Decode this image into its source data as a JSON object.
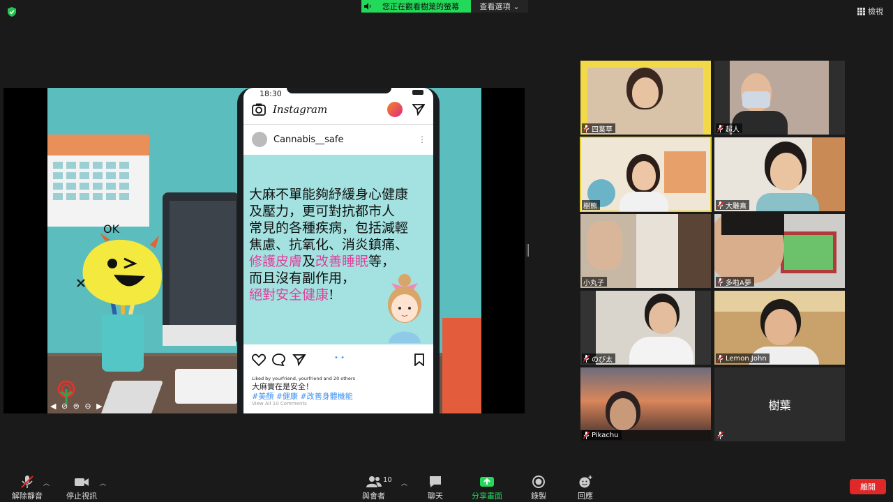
{
  "top": {
    "banner_text": "您正在觀看樹葉的螢幕",
    "view_options": "查看選項",
    "view_button": "檢視"
  },
  "slide": {
    "status_time": "18:30",
    "app_name": "Instagram",
    "account": "Cannabis__safe",
    "post_lines": [
      "大麻不單能夠紓緩身心健康",
      "及壓力，更可對抗都市人",
      "常見的各種疾病，包括減輕",
      "焦慮、抗氧化、消炎鎮痛、"
    ],
    "post_line5_hl1": "修護皮膚",
    "post_line5_mid": "及",
    "post_line5_hl2": "改善睡眠",
    "post_line5_end": "等，",
    "post_line6": "而且沒有副作用，",
    "post_line7_hl": "絕對安全健康",
    "post_line7_end": "!",
    "likes": "Liked by yourfriend, yourfriend and 20 others",
    "caption": "大麻實在是安全！",
    "hashtags": "#美顏 #健康 #改善身體機能",
    "view_comments": "View All 10 Comments",
    "monster_text": "OK"
  },
  "participants": [
    {
      "name": "四葉草",
      "muted": true
    },
    {
      "name": "超人",
      "muted": true
    },
    {
      "name": "樹熊",
      "muted": false
    },
    {
      "name": "大雕熹",
      "muted": true
    },
    {
      "name": "小丸子",
      "muted": false
    },
    {
      "name": "多啦A夢",
      "muted": true
    },
    {
      "name": "のび太",
      "muted": true
    },
    {
      "name": "Lemon John",
      "muted": true
    },
    {
      "name": "Pikachu",
      "muted": true
    },
    {
      "name": "樹葉",
      "muted": true
    }
  ],
  "toolbar": {
    "unmute": "解除靜音",
    "stop_video": "停止視訊",
    "participants": "與會者",
    "participant_count": "10",
    "chat": "聊天",
    "share_screen": "分享畫面",
    "record": "錄製",
    "reactions": "回應",
    "leave": "離開"
  },
  "colors": {
    "share_green": "#23d959",
    "active_speaker": "#ebd234",
    "leave_red": "#e02828",
    "hashtag_blue": "#3d8ff0",
    "highlight_pink": "#e0409c"
  }
}
